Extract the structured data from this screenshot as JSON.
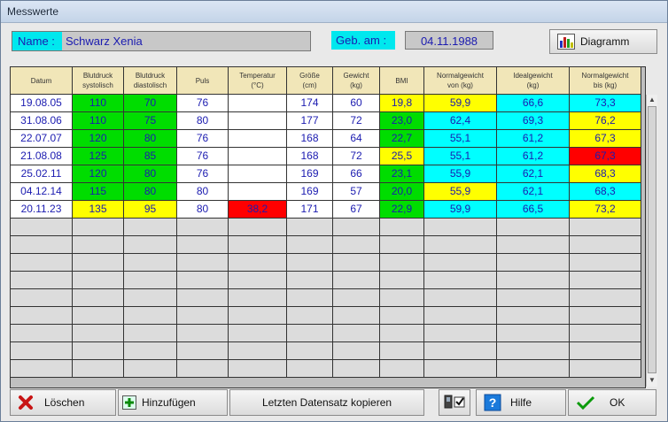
{
  "window": {
    "title": "Messwerte"
  },
  "patient": {
    "name_label": "Name :",
    "name": "Schwarz Xenia",
    "birth_label": "Geb. am :",
    "birth_date": "04.11.1988"
  },
  "toolbar": {
    "diagram_label": "Diagramm"
  },
  "table": {
    "headers": [
      [
        "Datum"
      ],
      [
        "Blutdruck",
        "systolisch"
      ],
      [
        "Blutdruck",
        "diastolisch"
      ],
      [
        "Puls"
      ],
      [
        "Temperatur",
        "(°C)"
      ],
      [
        "Größe",
        "(cm)"
      ],
      [
        "Gewicht",
        "(kg)"
      ],
      [
        "BMI"
      ],
      [
        "Normalgewicht",
        "von (kg)"
      ],
      [
        "Idealgewicht",
        "(kg)"
      ],
      [
        "Normalgewicht",
        "bis (kg)"
      ]
    ],
    "rows": [
      [
        "19.08.05",
        "110",
        "70",
        "76",
        "",
        "174",
        "60",
        "19,8",
        "59,9",
        "66,6",
        "73,3"
      ],
      [
        "31.08.06",
        "110",
        "75",
        "80",
        "",
        "177",
        "72",
        "23,0",
        "62,4",
        "69,3",
        "76,2"
      ],
      [
        "22.07.07",
        "120",
        "80",
        "76",
        "",
        "168",
        "64",
        "22,7",
        "55,1",
        "61,2",
        "67,3"
      ],
      [
        "21.08.08",
        "125",
        "85",
        "76",
        "",
        "168",
        "72",
        "25,5",
        "55,1",
        "61,2",
        "67,3"
      ],
      [
        "25.02.11",
        "120",
        "80",
        "76",
        "",
        "169",
        "66",
        "23,1",
        "55,9",
        "62,1",
        "68,3"
      ],
      [
        "04.12.14",
        "115",
        "80",
        "80",
        "",
        "169",
        "57",
        "20,0",
        "55,9",
        "62,1",
        "68,3"
      ],
      [
        "20.11.23",
        "135",
        "95",
        "80",
        "38,2",
        "171",
        "67",
        "22,9",
        "59,9",
        "66,5",
        "73,2"
      ]
    ],
    "row_colors": [
      [
        "#ffffff",
        "#00dd00",
        "#00dd00",
        "#ffffff",
        "#ffffff",
        "#ffffff",
        "#ffffff",
        "#ffff00",
        "#ffff00",
        "#00ffff",
        "#00ffff"
      ],
      [
        "#ffffff",
        "#00dd00",
        "#00dd00",
        "#ffffff",
        "#ffffff",
        "#ffffff",
        "#ffffff",
        "#00dd00",
        "#00ffff",
        "#00ffff",
        "#ffff00"
      ],
      [
        "#ffffff",
        "#00dd00",
        "#00dd00",
        "#ffffff",
        "#ffffff",
        "#ffffff",
        "#ffffff",
        "#00dd00",
        "#00ffff",
        "#00ffff",
        "#ffff00"
      ],
      [
        "#ffffff",
        "#00dd00",
        "#00dd00",
        "#ffffff",
        "#ffffff",
        "#ffffff",
        "#ffffff",
        "#ffff00",
        "#00ffff",
        "#00ffff",
        "#ff0000"
      ],
      [
        "#ffffff",
        "#00dd00",
        "#00dd00",
        "#ffffff",
        "#ffffff",
        "#ffffff",
        "#ffffff",
        "#00dd00",
        "#00ffff",
        "#00ffff",
        "#ffff00"
      ],
      [
        "#ffffff",
        "#00dd00",
        "#00dd00",
        "#ffffff",
        "#ffffff",
        "#ffffff",
        "#ffffff",
        "#00dd00",
        "#ffff00",
        "#00ffff",
        "#00ffff"
      ],
      [
        "#ffffff",
        "#ffff00",
        "#ffff00",
        "#ffffff",
        "#ff0000",
        "#ffffff",
        "#ffffff",
        "#00dd00",
        "#00ffff",
        "#00ffff",
        "#ffff00"
      ]
    ]
  },
  "buttons": {
    "delete": "Löschen",
    "add": "Hinzufügen",
    "copy_last": "Letzten Datensatz kopieren",
    "help": "Hilfe",
    "ok": "OK"
  }
}
